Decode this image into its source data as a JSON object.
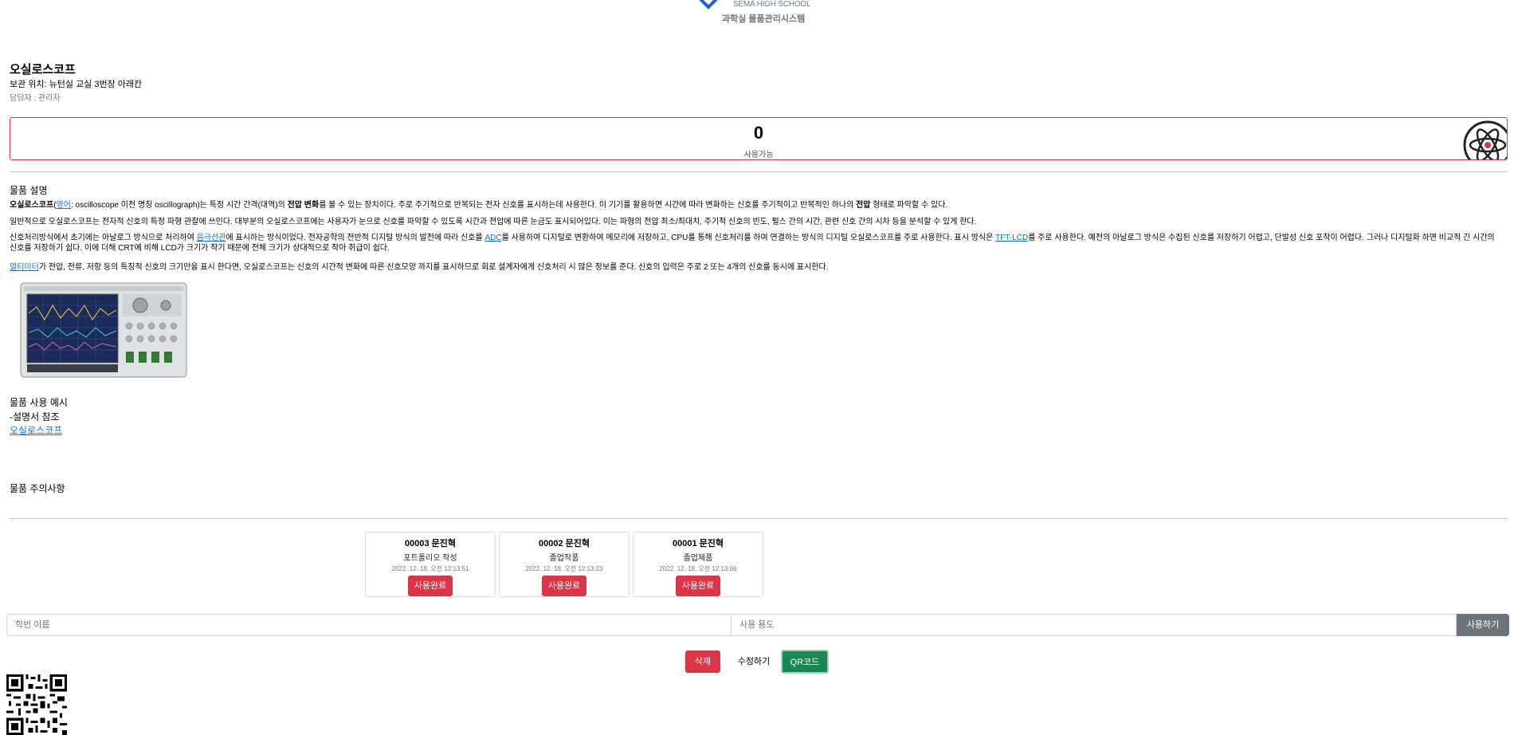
{
  "header": {
    "school_name": "SEMA HIGH SCHOOL",
    "system_name": "과학실 물품관리시스템"
  },
  "item": {
    "name": "오실로스코프",
    "location": "보관 위치: 뉴턴실 교실 3번장 아래칸",
    "manager": "담당자 : 관리자",
    "available_count": "0",
    "available_label": "사용가능"
  },
  "description": {
    "title": "물품 설명",
    "p1": {
      "term": "오실로스코프",
      "link_en": "영어",
      "text_a": ": oscilloscope 이전 명칭 oscillograph)는 특정 시간 간격(대역)의 ",
      "bold_a": "전압 변화",
      "text_b": "를 볼 수 있는 장치이다. 주로 주기적으로 반복되는 전자 신호를 표시하는데 사용한다. 이 기기를 활용하면 시간에 따라 변화하는 신호를 주기적이고 반복적인 하나의 ",
      "bold_b": "전압",
      "text_c": " 형태로 파악할 수 있다."
    },
    "p2": "일반적으로 오실로스코프는 전자적 신호의 특정 파형 관찰에 쓰인다. 대부분의 오실로스코프에는 사용자가 눈으로 신호를 파악할 수 있도록 시간과 전압에 따른 눈금도 표시되어있다. 이는 파형의 전압 최소/최대치, 주기적 신호의 빈도, 펄스 간의 시간, 관련 신호 간의 시차 등을 분석할 수 있게 한다.",
    "p3": {
      "text_a": "신호처리방식에서 초기에는 아날로그 방식으로 처리하여 ",
      "link_crt": "음극선관",
      "text_b": "에 표시하는 방식이었다. 전자공학의 전반적 디지털 방식의 발전에 따라 신호를 ",
      "link_adc": "ADC",
      "text_c": "를 사용하여 디지털로 변환하여 메모리에 저장하고, CPU를 통해 신호처리를 하여 연결하는 방식의 디지털 오실로스코프를 주로 사용한다. 표시 방식은 ",
      "link_lcd": "TFT-LCD",
      "text_d": "를 주로 사용한다. 예전의 아날로그 방식은 수집된 신호를 저장하기 어렵고, 단발성 신호 포착이 어렵다. 그러나 디지털화 하면 비교적 긴 시간의 신호를 저장하기 쉽다. 이에 더해 CRT에 비해 LCD가 크기가 작기 때문에 전체 크기가 상대적으로 작아 취급이 쉽다."
    },
    "p4": {
      "link_multimeter": "멀티미터",
      "text": "가 전압, 전류, 저항 등의 특징적 신호의 크기만을 표시 한다면, 오실로스코프는 신호의 시간적 변화에 따른 신호모양 까지를 표시하므로 회로 설계자에게 신호처리 시 많은 정보를 준다. 신호의 입력은 주로 2 또는 4개의 신호를 동시에 표시한다."
    }
  },
  "usage_example": {
    "title": "물품 사용 예시",
    "line1": "-설명서 참조",
    "link": "오실로스코프"
  },
  "caution": {
    "title": "물품 주의사항"
  },
  "records": [
    {
      "title": "00003 문진혁",
      "purpose": "포트폴리오 작성",
      "time": "2022. 12. 18. 오전 12:13:51",
      "button": "사용완료"
    },
    {
      "title": "00002 문진혁",
      "purpose": "졸업작품",
      "time": "2022. 12. 18. 오전 12:13:23",
      "button": "사용완료"
    },
    {
      "title": "00001 문진혁",
      "purpose": "졸업제품",
      "time": "2022. 12. 18. 오전 12:13:06",
      "button": "사용완료"
    }
  ],
  "form": {
    "id_placeholder": "학번 이름",
    "purpose_placeholder": "사용 용도",
    "submit_label": "사용하기"
  },
  "actions": {
    "delete_label": "삭제",
    "edit_label": "수정하기",
    "qr_label": "QR코드"
  },
  "icons": {
    "logo": "school-diamond-logo",
    "item": "atom-icon",
    "qr": "qr-code"
  },
  "colors": {
    "danger": "#dc3545",
    "success": "#198754",
    "secondary": "#6c757d",
    "link": "#0d6efd"
  }
}
